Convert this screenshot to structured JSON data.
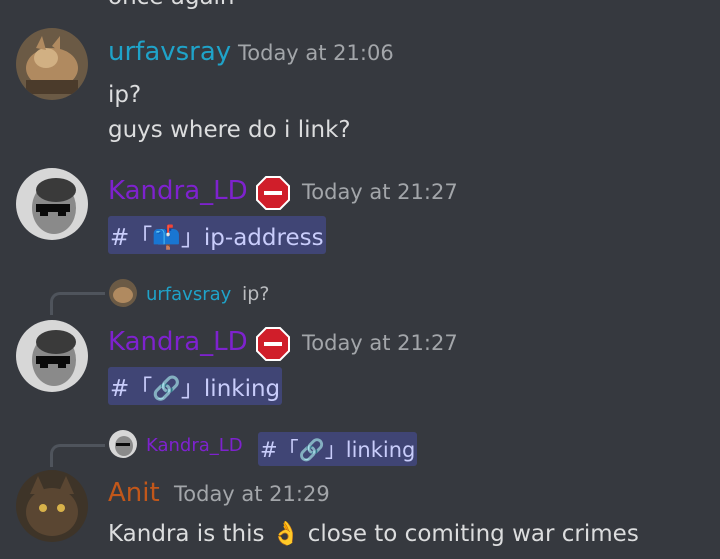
{
  "colors": {
    "background": "#36393f",
    "urfavsray": "#1fa3c9",
    "kandra": "#7e22ce",
    "anit": "#c2571a",
    "mention_bg": "#4a4f86"
  },
  "top_fragment": "once again",
  "messages": [
    {
      "username": "urfavsray",
      "timestamp": "Today at 21:06",
      "lines": [
        "ip?",
        "guys where do i link?"
      ]
    },
    {
      "username": "Kandra_LD",
      "badge_icon": "stop-sign-icon",
      "timestamp": "Today at 21:27",
      "channel_mention": "#「📫」ip-address"
    },
    {
      "reply": {
        "username": "urfavsray",
        "text": "ip?"
      },
      "username": "Kandra_LD",
      "badge_icon": "stop-sign-icon",
      "timestamp": "Today at 21:27",
      "channel_mention": "#「🔗」linking"
    },
    {
      "reply": {
        "username": "Kandra_LD",
        "text": "#「🔗」linking"
      },
      "username": "Anit",
      "timestamp": "Today at 21:29",
      "text_before": "Kandra is this",
      "emoji": "👌",
      "text_after": "close to comiting war crimes"
    }
  ]
}
